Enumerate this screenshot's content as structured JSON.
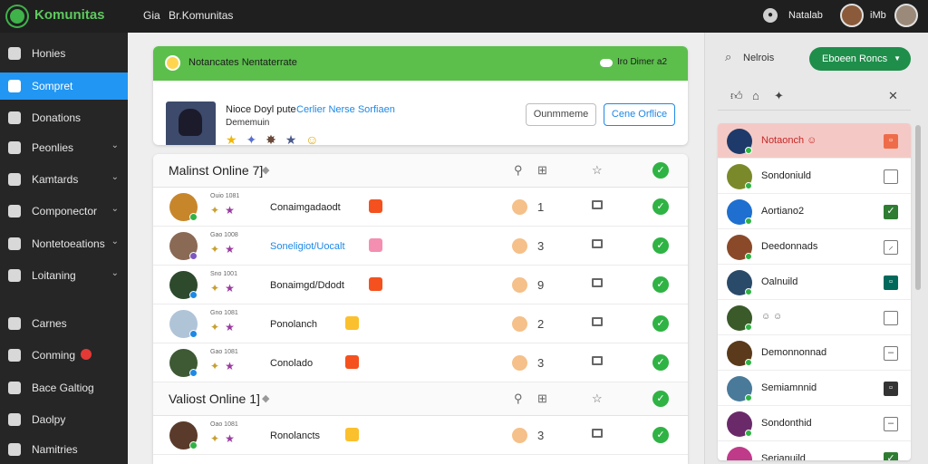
{
  "app": {
    "logo_text": "Komunitas",
    "brand_color": "#3fb24a"
  },
  "topbar": {
    "crumbs": [
      "Gia",
      "Br.Komunitas"
    ],
    "user_name": "Natalab",
    "user_short": "iMb"
  },
  "sidebar": {
    "items": [
      {
        "label": "Honies",
        "icon": "home-icon",
        "chevron": false
      },
      {
        "label": "Sompret",
        "icon": "comment-icon",
        "chevron": false,
        "active": true
      },
      {
        "label": "Donations",
        "icon": "puzzle-icon",
        "chevron": false
      },
      {
        "label": "Peonlies",
        "icon": "person-icon",
        "chevron": true
      },
      {
        "label": "Kamtards",
        "icon": "shield-icon",
        "chevron": true
      },
      {
        "label": "Componector",
        "icon": "monitor-icon",
        "chevron": true
      },
      {
        "label": "Nontetoeations",
        "icon": "grid-icon",
        "chevron": true
      },
      {
        "label": "Loitaning",
        "icon": "circle-icon",
        "chevron": true
      },
      {
        "label": "Carnes",
        "icon": "chart-icon",
        "chevron": false
      },
      {
        "label": "Conming",
        "icon": "house-icon",
        "chevron": false,
        "badge": true
      },
      {
        "label": "Bace Galtiog",
        "icon": "gallery-icon",
        "chevron": false
      },
      {
        "label": "Daolpy",
        "icon": "display-icon",
        "chevron": false
      },
      {
        "label": "Namitries",
        "icon": "user-icon",
        "chevron": false
      }
    ]
  },
  "card": {
    "title": "Notancates Nentaterrate",
    "status": "Iro Dimer",
    "status_extra": "a2",
    "name": "Nioce Doyl pute",
    "link": "Cerlier Nerse Sorfiaen",
    "subtitle": "Dememuin",
    "icons": [
      "★",
      "✦",
      "✸",
      "★",
      "☺"
    ],
    "button_secondary": "Ounmmeme",
    "button_primary": "Cene Orflice"
  },
  "sections": [
    {
      "title": "Malinst Online 7]",
      "rows": [
        {
          "meta": "Ouio 1081",
          "name": "Conaimgadaodt",
          "name_link": false,
          "badge_color": "#f4511e",
          "count": "1",
          "avatar": "#c8862b",
          "status_color": "#2fb344"
        },
        {
          "meta": "Gao 1008",
          "name": "Soneligiot/Uocalt",
          "name_link": true,
          "badge_color": "#f48fb1",
          "count": "3",
          "avatar": "#8a6a55",
          "status_color": "#7e57c2"
        },
        {
          "meta": "Sno 1001",
          "name": "Bonaimgd/Ddodt",
          "name_link": false,
          "badge_color": "#f4511e",
          "count": "9",
          "avatar": "#2d4a2d",
          "status_color": "#1e88e5"
        },
        {
          "meta": "Gno 1081",
          "name": "Ponolanch",
          "name_link": false,
          "badge_color": "#fbc02d",
          "count": "2",
          "avatar": "#b0c4d8",
          "status_color": "#1e88e5"
        },
        {
          "meta": "Gao 1081",
          "name": "Conolado",
          "name_link": false,
          "badge_color": "#f4511e",
          "count": "3",
          "avatar": "#3e5a35",
          "status_color": "#1e88e5"
        }
      ]
    },
    {
      "title": "Valiost Online 1]",
      "rows": [
        {
          "meta": "Oao 1081",
          "name": "Ronolancts",
          "name_link": false,
          "badge_color": "#fbc02d",
          "count": "3",
          "avatar": "#5a3a2a",
          "status_color": "#2fb344"
        }
      ]
    }
  ],
  "right_panel": {
    "search_label": "Nelrois",
    "select_label": "Eboeen Roncs",
    "people": [
      {
        "name": "Notaonch ☺",
        "box": "red",
        "box_glyph": "▫",
        "avatar": "#1e3a6a",
        "highlight": true
      },
      {
        "name": "Sondoniuld",
        "box": "none",
        "box_glyph": "",
        "avatar": "#7a8a2a"
      },
      {
        "name": "Aortiano2",
        "box": "green",
        "box_glyph": "✓",
        "avatar": "#1e6fd0"
      },
      {
        "name": "Deedonnads",
        "box": "none",
        "box_glyph": "⸝",
        "avatar": "#8a4a2a"
      },
      {
        "name": "Oalnuild",
        "box": "teal",
        "box_glyph": "▫",
        "avatar": "#2a4a6a"
      },
      {
        "name": "",
        "extra": "☺ ☺",
        "box": "none",
        "box_glyph": "",
        "avatar": "#3a5a2a"
      },
      {
        "name": "Demonnonnad",
        "box": "none",
        "box_glyph": "–",
        "avatar": "#5a3a1a"
      },
      {
        "name": "Semiamnnid",
        "box": "dark",
        "box_glyph": "▫",
        "avatar": "#4a7a9a"
      },
      {
        "name": "Sondonthid",
        "box": "none",
        "box_glyph": "–",
        "avatar": "#6a2a6a"
      },
      {
        "name": "Serianuild",
        "box": "green",
        "box_glyph": "✓",
        "avatar": "#c03a8a"
      }
    ]
  }
}
